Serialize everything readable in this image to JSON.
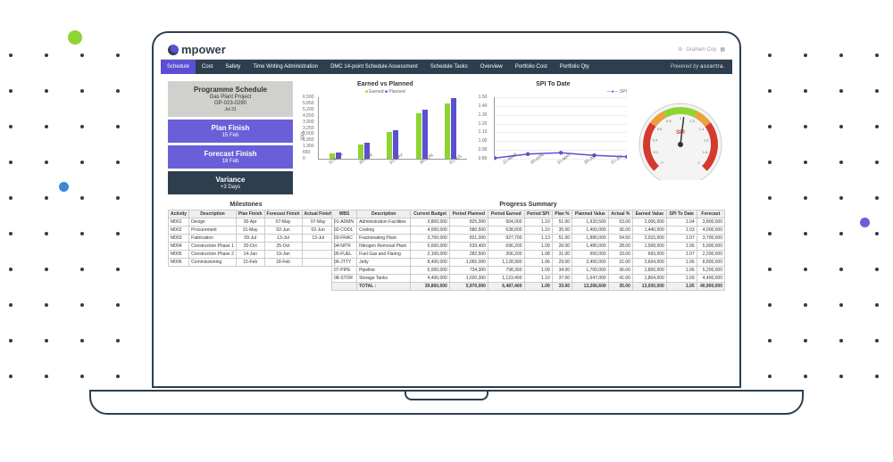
{
  "logo": "mpower",
  "user": "Graham Coy",
  "nav": [
    "Schedule",
    "Cost",
    "Safety",
    "Time Writing Administration",
    "DMC 14-point Schedule Assessment",
    "Schedule Tasks",
    "Overview",
    "Portfolio Cost",
    "Portfolio Qty"
  ],
  "nav_active": 0,
  "powered_prefix": "Powered by",
  "powered_brand": "ascertra.",
  "cards": {
    "prog": {
      "title": "Programme Schedule",
      "l1": "Gas Plant Project",
      "l2": "GP-023-0290",
      "l3": "Jul 31"
    },
    "plan": {
      "title": "Plan Finish",
      "sub": "15 Feb"
    },
    "fc": {
      "title": "Forecast Finish",
      "sub": "18 Feb"
    },
    "var": {
      "title": "Variance",
      "sub": "+3 Days"
    }
  },
  "chart_data": [
    {
      "type": "bar",
      "title": "Earned vs Planned",
      "legend": [
        "Earned",
        "Planned"
      ],
      "ylabel": "000s",
      "ylim": [
        0,
        6500
      ],
      "yticks": [
        0,
        650,
        1300,
        1950,
        2600,
        3250,
        3900,
        4550,
        5200,
        5850,
        6500
      ],
      "categories": [
        "31-MAR",
        "30-APR",
        "31-MAY",
        "30-JUN",
        "31-JUL"
      ],
      "series": [
        {
          "name": "Earned",
          "values": [
            600,
            1500,
            2800,
            4700,
            5800
          ]
        },
        {
          "name": "Planned",
          "values": [
            650,
            1700,
            3000,
            5100,
            6300
          ]
        }
      ]
    },
    {
      "type": "line",
      "title": "SPI To Date",
      "legend": [
        "SPI"
      ],
      "ylim": [
        0.8,
        1.5
      ],
      "yticks": [
        0.8,
        0.9,
        1.0,
        1.1,
        1.2,
        1.3,
        1.4,
        1.5
      ],
      "categories": [
        "31-MAR",
        "30-APR",
        "31-MAY",
        "30-JUN",
        "31-JUL"
      ],
      "series": [
        {
          "name": "SPI",
          "values": [
            1.04,
            1.07,
            1.08,
            1.06,
            1.05
          ]
        }
      ]
    },
    {
      "type": "gauge",
      "label": "SPI",
      "min": 0,
      "max": 2,
      "ticks": [
        0,
        0.2,
        0.4,
        0.6,
        0.8,
        1,
        1.2,
        1.4,
        1.6,
        1.8,
        2
      ],
      "zones": [
        {
          "from": 0.0,
          "to": 0.6,
          "color": "#d43a2f"
        },
        {
          "from": 0.6,
          "to": 0.8,
          "color": "#e8a23a"
        },
        {
          "from": 0.8,
          "to": 1.2,
          "color": "#8ed433"
        },
        {
          "from": 1.2,
          "to": 1.4,
          "color": "#e8a23a"
        },
        {
          "from": 1.4,
          "to": 2.0,
          "color": "#d43a2f"
        }
      ],
      "value": 1.05
    }
  ],
  "milestones": {
    "title": "Milestones",
    "headers": [
      "Activity",
      "Description",
      "Plan Finish",
      "Forecast Finish",
      "Actual Finish"
    ],
    "rows": [
      [
        "M001",
        "Design",
        "30-Apr",
        "07-May",
        "07-May"
      ],
      [
        "M002",
        "Procurement",
        "31-May",
        "02-Jun",
        "02-Jun"
      ],
      [
        "M003",
        "Fabrication",
        "09-Jul",
        "13-Jul",
        "13-Jul"
      ],
      [
        "M004",
        "Construction Phase 1",
        "20-Oct",
        "25-Oct",
        ""
      ],
      [
        "M005",
        "Construction Phase 2",
        "14-Jan",
        "19-Jan",
        ""
      ],
      [
        "M006",
        "Commissioning",
        "15-Feb",
        "18-Feb",
        ""
      ]
    ]
  },
  "progress": {
    "title": "Progress Summary",
    "headers": [
      "WBS",
      "Description",
      "Current Budget",
      "Period Planned",
      "Period Earned",
      "Period SPI",
      "Plan %",
      "Planned Value",
      "Actual %",
      "Earned Value",
      "SPI To Date",
      "Forecast"
    ],
    "rows": [
      [
        "01-ADMN",
        "Administration Facilities",
        "3,800,000",
        "825,000",
        "904,000",
        "1.10",
        "51.00",
        "1,920,500",
        "53.00",
        "2,006,000",
        "1.04",
        "3,800,000"
      ],
      [
        "02-COOL",
        "Cooling",
        "4,000,000",
        "580,500",
        "638,600",
        "1.10",
        "35.00",
        "1,400,000",
        "36.00",
        "1,440,000",
        "1.03",
        "4,000,000"
      ],
      [
        "03-FRAC",
        "Fractionating Plant",
        "3,700,000",
        "821,000",
        "927,700",
        "1.13",
        "51.00",
        "1,880,000",
        "54.50",
        "2,015,000",
        "1.07",
        "3,700,000"
      ],
      [
        "04-NITR",
        "Nitrogen Removal Plant",
        "5,600,000",
        "639,400",
        "696,200",
        "1.09",
        "26.00",
        "1,480,000",
        "28.00",
        "1,568,000",
        "1.06",
        "5,900,000"
      ],
      [
        "05-FUEL",
        "Fuel Gas and Flaring",
        "2,100,000",
        "282,500",
        "306,200",
        "1.08",
        "31.00",
        "650,000",
        "33.00",
        "693,000",
        "1.07",
        "2,200,000"
      ],
      [
        "06-JTTY",
        "Jetty",
        "8,400,000",
        "1,065,000",
        "1,128,900",
        "1.06",
        "29.00",
        "2,450,000",
        "31.00",
        "2,604,000",
        "1.06",
        "8,800,000"
      ],
      [
        "07-PIPE",
        "Pipeline",
        "5,000,000",
        "734,300",
        "798,300",
        "1.09",
        "34.00",
        "1,700,000",
        "36.00",
        "1,800,000",
        "1.06",
        "5,200,000"
      ],
      [
        "08-STOR",
        "Storage Tanks",
        "4,400,000",
        "1,020,300",
        "1,123,400",
        "1.10",
        "37.00",
        "1,647,000",
        "41.00",
        "1,804,000",
        "1.09",
        "4,400,000"
      ]
    ],
    "total": [
      "",
      "TOTAL :",
      "39,800,000",
      "5,970,000",
      "6,487,400",
      "1.09",
      "33.00",
      "13,266,600",
      "35.00",
      "13,930,000",
      "1.05",
      "40,900,000"
    ]
  }
}
